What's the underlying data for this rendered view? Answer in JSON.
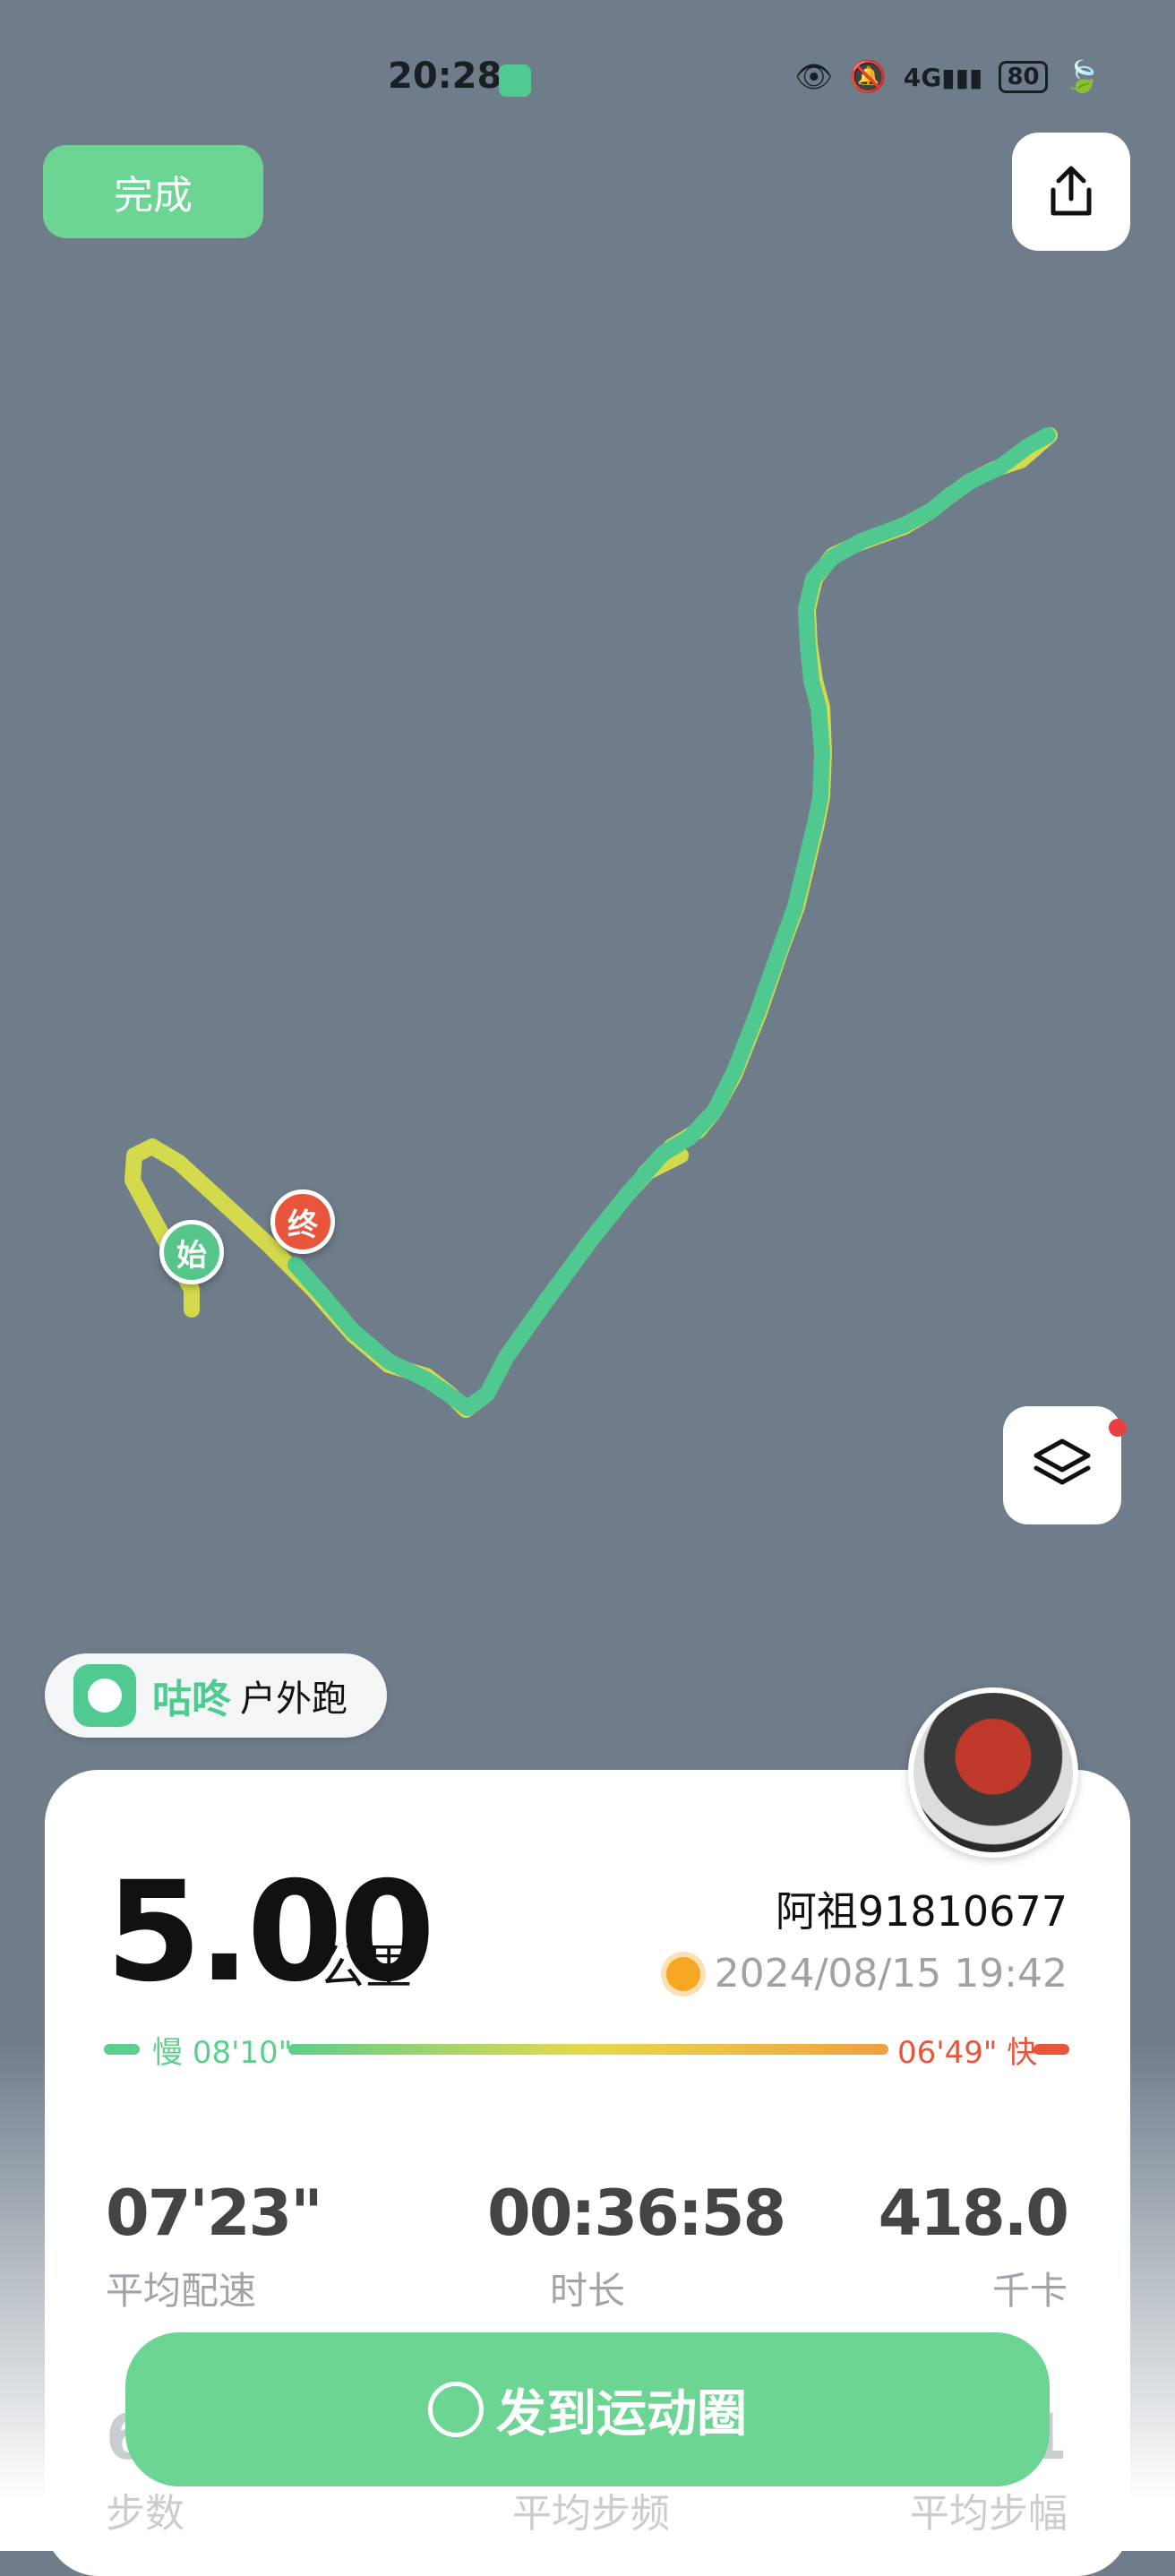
{
  "status_bar": {
    "time": "20:28",
    "battery": "80"
  },
  "header": {
    "done_label": "完成"
  },
  "icons": {
    "share": "share-icon",
    "layers": "layers-icon"
  },
  "map": {
    "start_label": "始",
    "end_label": "终"
  },
  "brand": {
    "name": "咕咚",
    "activity": "户外跑"
  },
  "summary": {
    "distance": "5.00",
    "distance_unit": "公里",
    "username": "阿祖91810677",
    "datetime": "2024/08/15 19:42",
    "pace_slow_label": "慢",
    "pace_slow": "08'10\"",
    "pace_fast": "06'49\"",
    "pace_fast_label": "快"
  },
  "stats": [
    {
      "value": "07'23\"",
      "label": "平均配速"
    },
    {
      "value": "00:36:58",
      "label": "时长"
    },
    {
      "value": "418.0",
      "label": "千卡"
    }
  ],
  "stats_row2": [
    {
      "value": "6",
      "label": "步数"
    },
    {
      "value": "",
      "label": "平均步频"
    },
    {
      "value": "1",
      "label": "平均步幅"
    }
  ],
  "actions": {
    "post_label": "发到运动圈"
  },
  "colors": {
    "accent": "#6cd593",
    "route": "#4fc98f",
    "route_alt": "#d3da4c",
    "end_marker": "#e8553b",
    "map_bg": "#6f7d8a"
  }
}
